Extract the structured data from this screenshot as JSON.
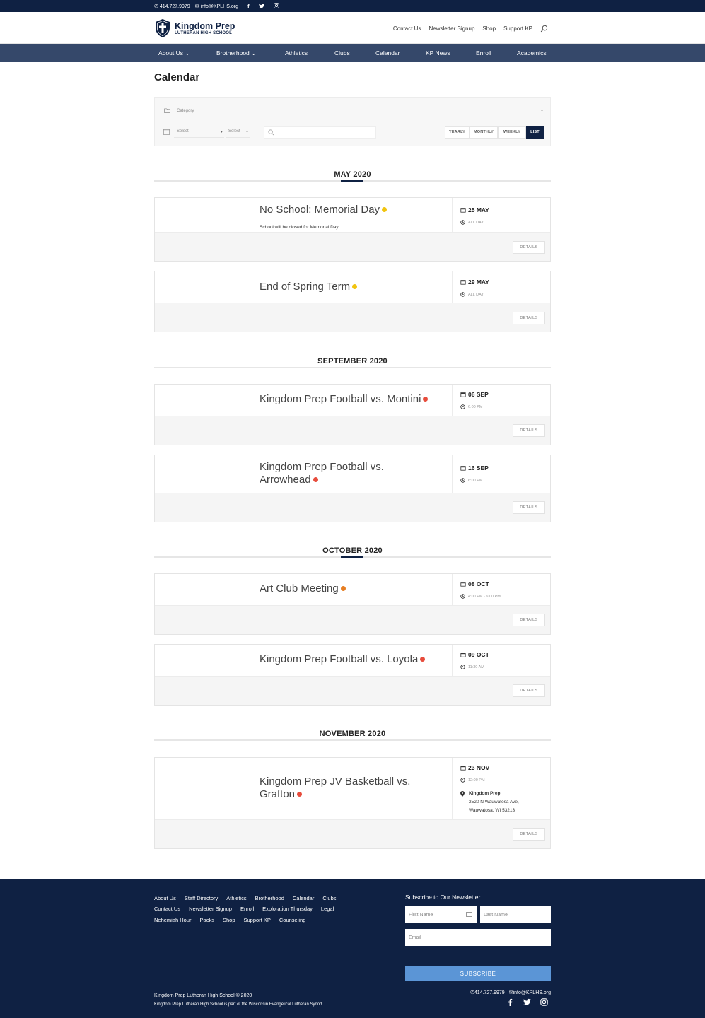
{
  "topbar": {
    "phone": "414.727.9979",
    "email": "info@KPLHS.org",
    "social_icons": [
      "facebook-icon",
      "twitter-icon",
      "instagram-icon"
    ]
  },
  "brand": {
    "name": "Kingdom Prep",
    "sub": "LUTHERAN HIGH SCHOOL",
    "color": "#0f2143"
  },
  "header_nav": [
    "Contact Us",
    "Newsletter Signup",
    "Shop",
    "Support KP"
  ],
  "main_nav": [
    {
      "label": "About Us",
      "caret": "⌄"
    },
    {
      "label": "Brotherhood",
      "caret": "⌄"
    },
    {
      "label": "Athletics"
    },
    {
      "label": "Clubs"
    },
    {
      "label": "Calendar"
    },
    {
      "label": "KP News"
    },
    {
      "label": "Enroll"
    },
    {
      "label": "Academics"
    }
  ],
  "page_title": "Calendar",
  "filter": {
    "category_placeholder": "Category",
    "select1": "Select",
    "select2": "Select",
    "views": [
      "YEARLY",
      "MONTHLY",
      "WEEKLY",
      "LIST"
    ],
    "active_view": "LIST"
  },
  "months": {
    "may": "MAY 2020",
    "sep": "SEPTEMBER 2020",
    "oct": "OCTOBER 2020",
    "nov": "NOVEMBER 2020"
  },
  "events": [
    {
      "title": "No School: Memorial Day",
      "desc": "School will be closed for Memorial Day. ...",
      "date": "25 MAY",
      "time": "ALL DAY",
      "color": "#f1c40f"
    },
    {
      "title": "End of Spring Term",
      "date": "29 MAY",
      "time": "ALL DAY",
      "color": "#f1c40f"
    },
    {
      "title": "Kingdom Prep Football vs. Montini",
      "date": "06 SEP",
      "time": "6:00 PM",
      "color": "#e74c3c"
    },
    {
      "title_line1": "Kingdom Prep Football vs.",
      "title_line2": "Arrowhead",
      "date": "16 SEP",
      "time": "6:00 PM",
      "color": "#e74c3c"
    },
    {
      "title": "Art Club Meeting",
      "date": "08 OCT",
      "time": "4:00 PM - 6:00 PM",
      "color": "#e67e22"
    },
    {
      "title": "Kingdom Prep Football vs. Loyola",
      "date": "09 OCT",
      "time": "11:30 AM",
      "color": "#e74c3c"
    },
    {
      "title_line1": "Kingdom Prep JV Basketball vs.",
      "title_line2": "Grafton",
      "date": "23 NOV",
      "time": "12:00 PM",
      "color": "#e74c3c",
      "location_name": "Kingdom Prep",
      "location_line1": "2520 N Wauwatosa Ave,",
      "location_line2": "Wauwatosa, WI 53213"
    }
  ],
  "details_label": "DETAILS",
  "footer": {
    "links_row1": [
      "About Us",
      "Staff Directory",
      "Athletics",
      "Brotherhood",
      "Calendar",
      "Clubs"
    ],
    "links_row2": [
      "Contact Us",
      "Newsletter Signup",
      "Enroll",
      "Exploration Thursday",
      "Legal"
    ],
    "links_row3": [
      "Nehemiah Hour",
      "Packs",
      "Shop",
      "Support KP",
      "Counseling"
    ],
    "newsletter_title": "Subscribe to Our Newsletter",
    "first_name": "First Name",
    "last_name": "Last Name",
    "email": "Email",
    "subscribe": "SUBSCRIBE",
    "copyright": "Kingdom Prep Lutheran High School © 2020",
    "synod": "Kingdom Prep Lutheran High School is part of the Wisconsin Evangelical Lutheran Synod",
    "phone": "414.727.9979",
    "email_contact": "info@KPLHS.org",
    "accent": "#5b95d6"
  }
}
